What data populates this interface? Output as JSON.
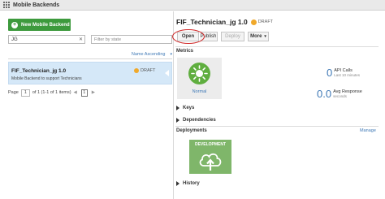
{
  "window": {
    "title": "Mobile Backends"
  },
  "left": {
    "new_button_label": "New Mobile Backend",
    "search_value": "JG",
    "filter_placeholder": "Filter by state",
    "sort_label": "Name Ascending",
    "items": [
      {
        "name": "FIF_Technician_jg 1.0",
        "description": "Mobile Backend to support Technicians",
        "status": "DRAFT",
        "status_color": "#f0a92b"
      }
    ],
    "pager": {
      "page_label": "Page",
      "page_value": "1",
      "of_text": "of 1 (1-1 of 1 items)",
      "current_page": "1"
    }
  },
  "detail": {
    "title": "FIF_Technician_jg 1.0",
    "status": "DRAFT",
    "toolbar": {
      "open": "Open",
      "publish": "Publish",
      "deploy": "Deploy",
      "more": "More"
    },
    "metrics": {
      "section_label": "Metrics",
      "health_label": "Normal",
      "api_calls_value": "0",
      "api_calls_label": "API Calls",
      "api_calls_sub": "Last 10 minutes",
      "avg_response_value": "0.0",
      "avg_response_label": "Avg Response",
      "avg_response_sub": "seconds"
    },
    "keys_label": "Keys",
    "dependencies_label": "Dependencies",
    "deployments": {
      "section_label": "Deployments",
      "manage_label": "Manage",
      "environment": "DEVELOPMENT"
    },
    "history_label": "History"
  },
  "colors": {
    "accent": "#3f79b6",
    "brand_green": "#3d9a3d",
    "selection": "#d5e8f8",
    "highlight_ring": "#d12a2a"
  }
}
